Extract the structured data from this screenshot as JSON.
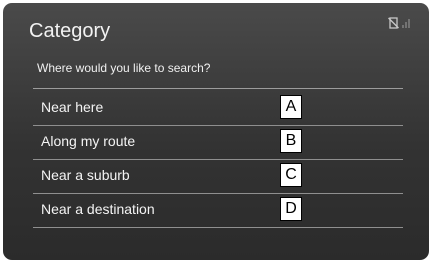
{
  "header": {
    "title": "Category",
    "status_icons": [
      "phone-off-icon",
      "signal-icon"
    ]
  },
  "search": {
    "prompt": "Where would you like to search?"
  },
  "options": [
    {
      "label": "Near here",
      "badge": "A"
    },
    {
      "label": "Along my route",
      "badge": "B"
    },
    {
      "label": "Near a suburb",
      "badge": "C"
    },
    {
      "label": "Near a destination",
      "badge": "D"
    }
  ],
  "colors": {
    "background": "#3a3a3a",
    "text": "#f4f4f4",
    "divider": "#8f8f8f",
    "badge_background": "#ffffff",
    "badge_text": "#000000"
  }
}
